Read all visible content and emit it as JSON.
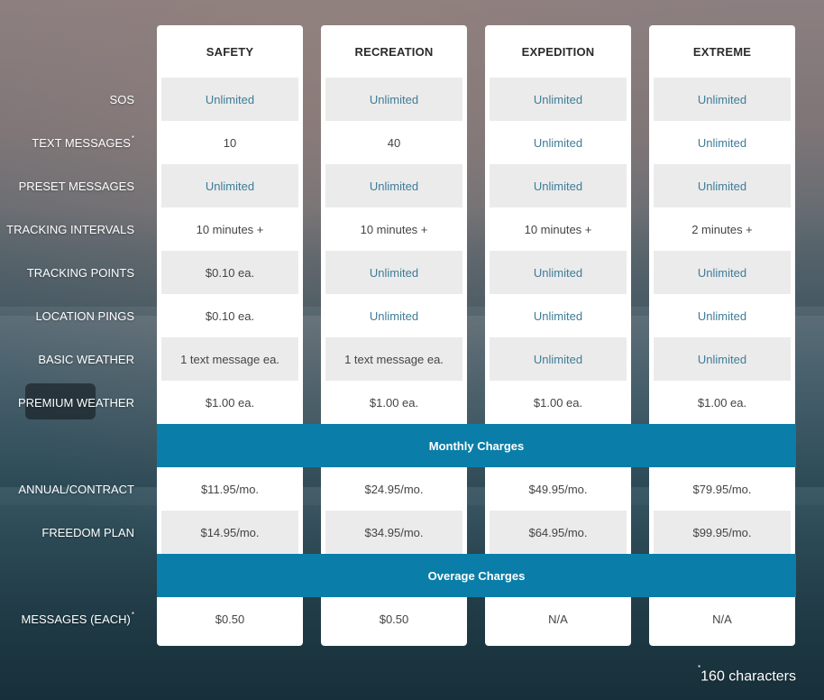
{
  "plans": [
    "SAFETY",
    "RECREATION",
    "EXPEDITION",
    "EXTREME"
  ],
  "features": [
    {
      "label": "SOS",
      "mark": "",
      "values": [
        "Unlimited",
        "Unlimited",
        "Unlimited",
        "Unlimited"
      ]
    },
    {
      "label": "TEXT MESSAGES",
      "mark": "*",
      "values": [
        "10",
        "40",
        "Unlimited",
        "Unlimited"
      ]
    },
    {
      "label": "PRESET MESSAGES",
      "mark": "",
      "values": [
        "Unlimited",
        "Unlimited",
        "Unlimited",
        "Unlimited"
      ]
    },
    {
      "label": "TRACKING INTERVALS",
      "mark": "",
      "values": [
        "10 minutes +",
        "10 minutes +",
        "10 minutes +",
        "2 minutes +"
      ]
    },
    {
      "label": "TRACKING POINTS",
      "mark": "",
      "values": [
        "$0.10 ea.",
        "Unlimited",
        "Unlimited",
        "Unlimited"
      ]
    },
    {
      "label": "LOCATION PINGS",
      "mark": "",
      "values": [
        "$0.10 ea.",
        "Unlimited",
        "Unlimited",
        "Unlimited"
      ]
    },
    {
      "label": "BASIC WEATHER",
      "mark": "",
      "values": [
        "1 text message ea.",
        "1 text message ea.",
        "Unlimited",
        "Unlimited"
      ]
    },
    {
      "label": "PREMIUM WEATHER",
      "mark": "",
      "values": [
        "$1.00 ea.",
        "$1.00 ea.",
        "$1.00 ea.",
        "$1.00 ea."
      ]
    }
  ],
  "monthly": {
    "title": "Monthly Charges",
    "rows": [
      {
        "label": "ANNUAL/CONTRACT",
        "mark": "",
        "values": [
          "$11.95/mo.",
          "$24.95/mo.",
          "$49.95/mo.",
          "$79.95/mo."
        ]
      },
      {
        "label": "FREEDOM PLAN",
        "mark": "",
        "values": [
          "$14.95/mo.",
          "$34.95/mo.",
          "$64.95/mo.",
          "$99.95/mo."
        ]
      }
    ]
  },
  "overage": {
    "title": "Overage Charges",
    "rows": [
      {
        "label": "MESSAGES (EACH)",
        "mark": "*",
        "values": [
          "$0.50",
          "$0.50",
          "N/A",
          "N/A"
        ]
      }
    ]
  },
  "footnote": {
    "mark": "*",
    "text": "160 characters"
  },
  "colors": {
    "accent_band": "#0a7ea8",
    "unlimited_text": "#3f7c98",
    "shaded_cell": "#ebebeb"
  }
}
